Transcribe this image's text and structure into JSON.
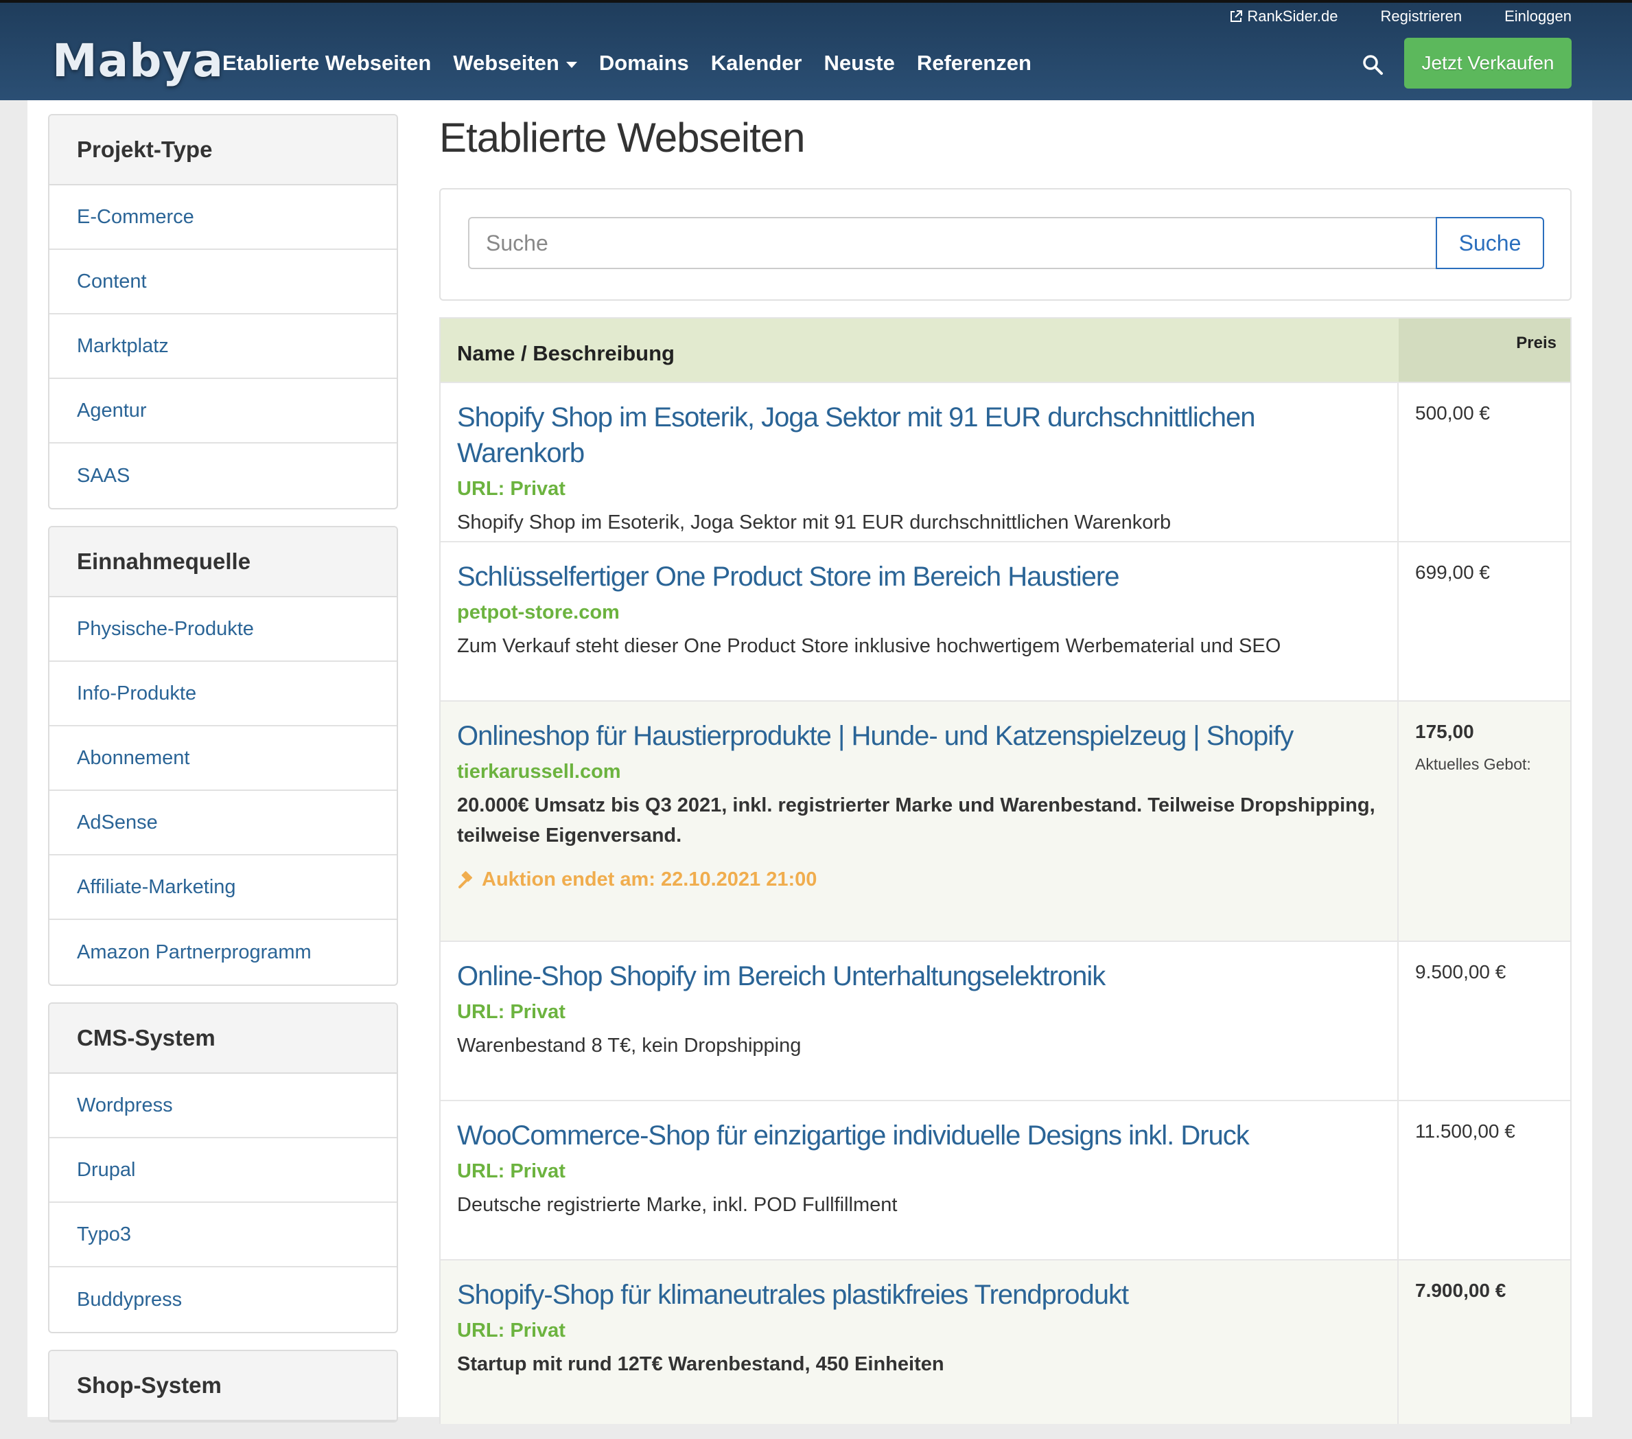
{
  "header": {
    "utility_links": {
      "ranksider": "RankSider.de",
      "register": "Registrieren",
      "login": "Einloggen"
    },
    "logo": "Mabya",
    "nav": [
      {
        "label": "Etablierte Webseiten"
      },
      {
        "label": "Webseiten"
      },
      {
        "label": "Domains"
      },
      {
        "label": "Kalender"
      },
      {
        "label": "Neuste"
      },
      {
        "label": "Referenzen"
      }
    ],
    "sell_button": "Jetzt Verkaufen"
  },
  "sidebar": {
    "panels": [
      {
        "title": "Projekt-Type",
        "items": [
          "E-Commerce",
          "Content",
          "Marktplatz",
          "Agentur",
          "SAAS"
        ]
      },
      {
        "title": "Einnahmequelle",
        "items": [
          "Physische-Produkte",
          "Info-Produkte",
          "Abonnement",
          "AdSense",
          "Affiliate-Marketing",
          "Amazon Partnerprogramm"
        ]
      },
      {
        "title": "CMS-System",
        "items": [
          "Wordpress",
          "Drupal",
          "Typo3",
          "Buddypress"
        ]
      },
      {
        "title": "Shop-System",
        "items": []
      }
    ]
  },
  "main": {
    "title": "Etablierte Webseiten",
    "search": {
      "placeholder": "Suche",
      "button": "Suche"
    },
    "table": {
      "col_name": "Name / Beschreibung",
      "col_price": "Preis"
    },
    "listings": [
      {
        "title": "Shopify Shop im Esoterik, Joga Sektor mit 91 EUR durchschnittlichen Warenkorb",
        "url": "URL: Privat",
        "desc": "Shopify Shop im Esoterik, Joga Sektor mit 91 EUR durchschnittlichen Warenkorb",
        "price": "500,00 €"
      },
      {
        "title": "Schlüsselfertiger One Product Store im Bereich Haustiere",
        "url": "petpot-store.com",
        "desc": "Zum Verkauf steht dieser One Product Store inklusive hochwertigem Werbematerial und SEO",
        "price": "699,00 €"
      },
      {
        "title": "Onlineshop für Haustierprodukte | Hunde- und Katzenspielzeug | Shopify",
        "url": "tierkarussell.com",
        "desc": "20.000€ Umsatz bis Q3 2021, inkl. registrierter Marke und Warenbestand. Teilweise Dropshipping, teilweise Eigenversand.",
        "auction": "Auktion endet am: 22.10.2021 21:00",
        "price": "175,00",
        "bid_label": "Aktuelles Gebot:"
      },
      {
        "title": "Online-Shop Shopify im Bereich Unterhaltungselektronik",
        "url": "URL: Privat",
        "desc": "Warenbestand 8 T€, kein Dropshipping",
        "price": "9.500,00 €"
      },
      {
        "title": "WooCommerce-Shop für einzigartige individuelle Designs inkl. Druck",
        "url": "URL: Privat",
        "desc": "Deutsche registrierte Marke, inkl. POD Fullfillment",
        "price": "11.500,00 €"
      },
      {
        "title": "Shopify-Shop für klimaneutrales plastikfreies Trendprodukt",
        "url": "URL: Privat",
        "desc": "Startup mit rund 12T€ Warenbestand, 450 Einheiten",
        "price": "7.900,00 €"
      }
    ]
  },
  "colors": {
    "navbar": "#2b4f74",
    "link": "#2a6496",
    "url_green": "#6cb33f",
    "sell_button": "#5cb85c",
    "auction_orange": "#f0ad4e",
    "table_header": "#e2eacf"
  }
}
